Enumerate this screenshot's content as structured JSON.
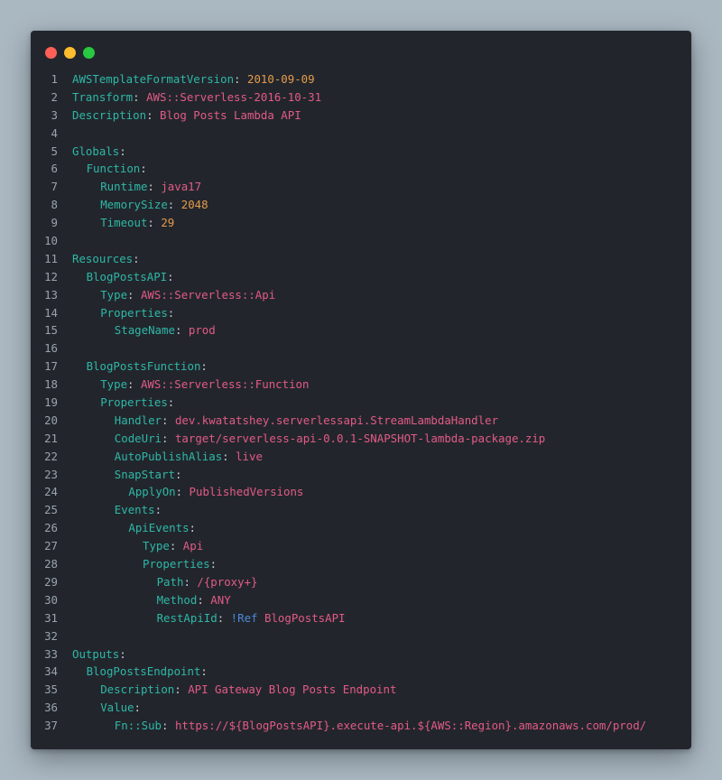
{
  "window": {
    "controls": [
      {
        "name": "close",
        "color": "#ff5f57"
      },
      {
        "name": "minimize",
        "color": "#febc2e"
      },
      {
        "name": "maximize",
        "color": "#28c840"
      }
    ]
  },
  "colors": {
    "key": "#2fb7a8",
    "string": "#e45a86",
    "number": "#e59a4b",
    "tag": "#4e86d8",
    "punct": "#c5cbd3",
    "line_number": "#9aa3ad"
  },
  "code": [
    {
      "n": "1",
      "indent": 0,
      "key": "AWSTemplateFormatVersion",
      "value": "2010-09-09",
      "vtype": "n"
    },
    {
      "n": "2",
      "indent": 0,
      "key": "Transform",
      "value": "AWS::Serverless-2016-10-31",
      "vtype": "s"
    },
    {
      "n": "3",
      "indent": 0,
      "key": "Description",
      "value": "Blog Posts Lambda API",
      "vtype": "s"
    },
    {
      "n": "4",
      "indent": 0
    },
    {
      "n": "5",
      "indent": 0,
      "key": "Globals"
    },
    {
      "n": "6",
      "indent": 1,
      "key": "Function"
    },
    {
      "n": "7",
      "indent": 2,
      "key": "Runtime",
      "value": "java17",
      "vtype": "s"
    },
    {
      "n": "8",
      "indent": 2,
      "key": "MemorySize",
      "value": "2048",
      "vtype": "n"
    },
    {
      "n": "9",
      "indent": 2,
      "key": "Timeout",
      "value": "29",
      "vtype": "n"
    },
    {
      "n": "10",
      "indent": 0
    },
    {
      "n": "11",
      "indent": 0,
      "key": "Resources"
    },
    {
      "n": "12",
      "indent": 1,
      "key": "BlogPostsAPI"
    },
    {
      "n": "13",
      "indent": 2,
      "key": "Type",
      "value": "AWS::Serverless::Api",
      "vtype": "s"
    },
    {
      "n": "14",
      "indent": 2,
      "key": "Properties"
    },
    {
      "n": "15",
      "indent": 3,
      "key": "StageName",
      "value": "prod",
      "vtype": "s"
    },
    {
      "n": "16",
      "indent": 0
    },
    {
      "n": "17",
      "indent": 1,
      "key": "BlogPostsFunction"
    },
    {
      "n": "18",
      "indent": 2,
      "key": "Type",
      "value": "AWS::Serverless::Function",
      "vtype": "s"
    },
    {
      "n": "19",
      "indent": 2,
      "key": "Properties"
    },
    {
      "n": "20",
      "indent": 3,
      "key": "Handler",
      "value": "dev.kwatatshey.serverlessapi.StreamLambdaHandler",
      "vtype": "s"
    },
    {
      "n": "21",
      "indent": 3,
      "key": "CodeUri",
      "value": "target/serverless-api-0.0.1-SNAPSHOT-lambda-package.zip",
      "vtype": "s"
    },
    {
      "n": "22",
      "indent": 3,
      "key": "AutoPublishAlias",
      "value": "live",
      "vtype": "s"
    },
    {
      "n": "23",
      "indent": 3,
      "key": "SnapStart"
    },
    {
      "n": "24",
      "indent": 4,
      "key": "ApplyOn",
      "value": "PublishedVersions",
      "vtype": "s"
    },
    {
      "n": "25",
      "indent": 3,
      "key": "Events"
    },
    {
      "n": "26",
      "indent": 4,
      "key": "ApiEvents"
    },
    {
      "n": "27",
      "indent": 5,
      "key": "Type",
      "value": "Api",
      "vtype": "s"
    },
    {
      "n": "28",
      "indent": 5,
      "key": "Properties"
    },
    {
      "n": "29",
      "indent": 6,
      "key": "Path",
      "value": "/{proxy+}",
      "vtype": "s"
    },
    {
      "n": "30",
      "indent": 6,
      "key": "Method",
      "value": "ANY",
      "vtype": "s"
    },
    {
      "n": "31",
      "indent": 6,
      "key": "RestApiId",
      "tag": "!Ref",
      "value": "BlogPostsAPI",
      "vtype": "s"
    },
    {
      "n": "32",
      "indent": 0
    },
    {
      "n": "33",
      "indent": 0,
      "key": "Outputs"
    },
    {
      "n": "34",
      "indent": 1,
      "key": "BlogPostsEndpoint"
    },
    {
      "n": "35",
      "indent": 2,
      "key": "Description",
      "value": "API Gateway Blog Posts Endpoint",
      "vtype": "s"
    },
    {
      "n": "36",
      "indent": 2,
      "key": "Value"
    },
    {
      "n": "37",
      "indent": 3,
      "key": "Fn::Sub",
      "value": "https://${BlogPostsAPI}.execute-api.${AWS::Region}.amazonaws.com/prod/",
      "vtype": "s"
    }
  ]
}
